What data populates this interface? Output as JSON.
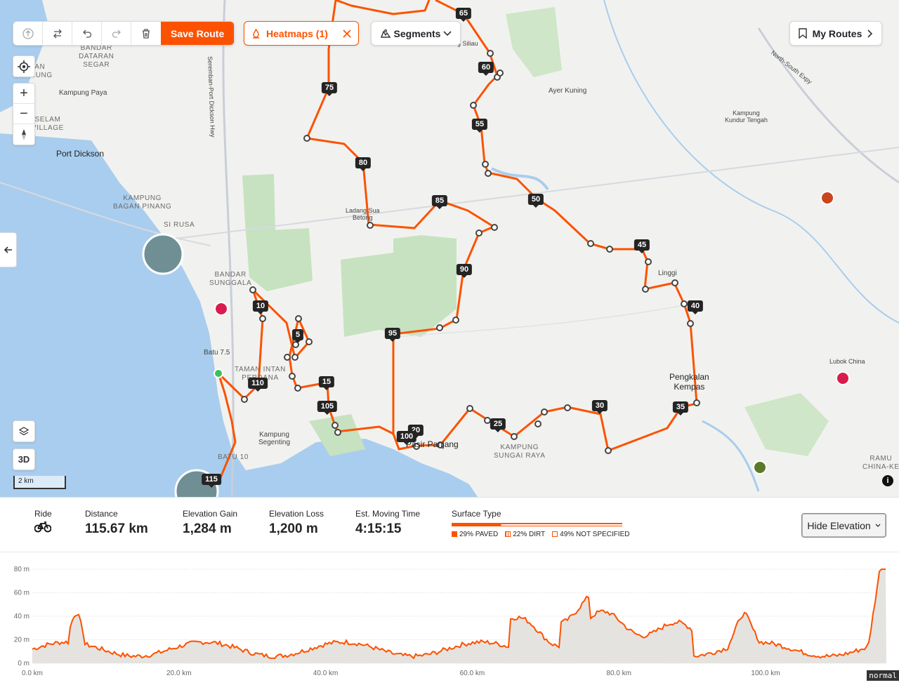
{
  "toolbar": {
    "buttons": [
      "upload-icon",
      "reverse-icon",
      "undo-icon",
      "redo-icon",
      "trash-icon"
    ],
    "save_label": "Save Route"
  },
  "heatmaps": {
    "label": "Heatmaps (1)"
  },
  "segments": {
    "label": "Segments"
  },
  "my_routes": {
    "label": "My Routes"
  },
  "map_controls": {
    "three_d": "3D",
    "scale": "2 km"
  },
  "map_labels": {
    "port_dickson": "Port Dickson",
    "kampung_paya": "Kampung Paya",
    "bandar_dataran_segar": "BANDAR\nDATARAN\nSEGAR",
    "taman": "MAN\nANJUNG",
    "selam_village": "SELAM\nVILLAGE",
    "kampung_bagan_pinang": "KAMPUNG\nBAGAN PINANG",
    "si_rusa": "SI RUSA",
    "bandar_sunggala": "BANDAR\nSUNGGALA",
    "batu_75": "Batu 7.5",
    "taman_intan": "TAMAN INTAN\nPERDANA",
    "kampung_segenting": "Kampung\nSegenting",
    "batu_10": "BATU 10",
    "ladang": "Ladang Sua\nBetong",
    "ayer_kuning": "Ayer Kuning",
    "kampung_kundur": "Kampung\nKundur Tengah",
    "linggi": "Linggi",
    "pengkalan_kempas": "Pengkalan\nKempas",
    "lubok_china": "Lubok China",
    "pasir_panjang": "Pasir Panjang",
    "kampung_sungai_raya": "KAMPUNG\nSUNGAI RAYA",
    "ramuan_china": "RAMU\nCHINA-KE",
    "sg_siliau": "Sg Siliau",
    "seremban_hwy": "Seremban-Port Dickson Hwy",
    "north_south": "North-South Expy"
  },
  "km_markers": [
    "5",
    "10",
    "15",
    "20",
    "25",
    "30",
    "35",
    "40",
    "45",
    "50",
    "55",
    "60",
    "65",
    "75",
    "80",
    "85",
    "90",
    "95",
    "100",
    "105",
    "110",
    "115"
  ],
  "stats": {
    "ride_label": "Ride",
    "distance_label": "Distance",
    "distance": "115.67 km",
    "gain_label": "Elevation Gain",
    "gain": "1,284 m",
    "loss_label": "Elevation Loss",
    "loss": "1,200 m",
    "time_label": "Est. Moving Time",
    "time": "4:15:15",
    "surface_label": "Surface Type",
    "paved": "29% PAVED",
    "dirt": "22% DIRT",
    "unspecified": "49% NOT SPECIFIED",
    "paved_fraction": 0.29,
    "dirt_fraction": 0.22,
    "unspecified_fraction": 0.49
  },
  "hide_elevation": "Hide Elevation",
  "elevation": {
    "y_ticks": [
      "80 m",
      "60 m",
      "40 m",
      "20 m",
      "0 m"
    ],
    "x_ticks": [
      "0.0 km",
      "20.0 km",
      "40.0 km",
      "60.0 km",
      "80.0 km",
      "100.0 km"
    ],
    "mode_tag": "normal"
  },
  "colors": {
    "accent": "#fc5200",
    "water": "#a9cdee",
    "park": "#c7e2c0"
  }
}
